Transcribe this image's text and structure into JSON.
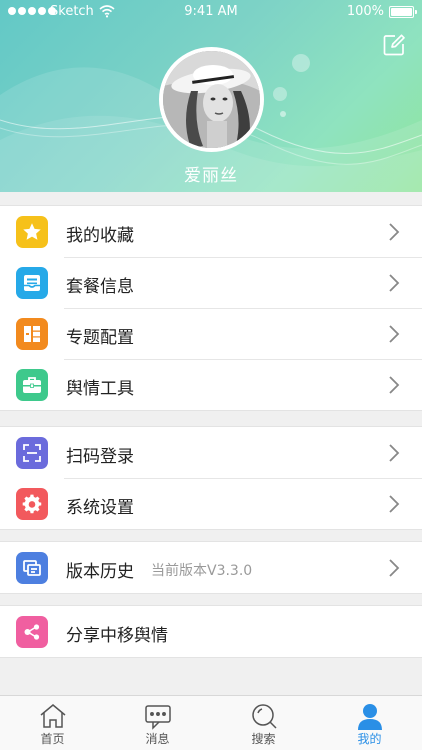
{
  "status_bar": {
    "carrier": "Sketch",
    "time": "9:41 AM",
    "battery": "100%"
  },
  "profile": {
    "name": "爱丽丝"
  },
  "menu": {
    "group1": [
      {
        "label": "我的收藏",
        "icon": "star-icon",
        "color": "#f6c11a"
      },
      {
        "label": "套餐信息",
        "icon": "tray-icon",
        "color": "#26a9e8"
      },
      {
        "label": "专题配置",
        "icon": "grid-icon",
        "color": "#f28a1e"
      },
      {
        "label": "舆情工具",
        "icon": "briefcase-icon",
        "color": "#3ec98c"
      }
    ],
    "group2": [
      {
        "label": "扫码登录",
        "icon": "scan-icon",
        "color": "#6b6bdc"
      },
      {
        "label": "系统设置",
        "icon": "gear-icon",
        "color": "#f2595d"
      }
    ],
    "group3": [
      {
        "label": "版本历史",
        "sub": "当前版本V3.3.0",
        "icon": "version-icon",
        "color": "#4d7fe0"
      }
    ],
    "group4": [
      {
        "label": "分享中移舆情",
        "icon": "share-icon",
        "color": "#f05fa0"
      }
    ]
  },
  "tabbar": [
    {
      "label": "首页",
      "icon": "home-icon"
    },
    {
      "label": "消息",
      "icon": "message-icon"
    },
    {
      "label": "搜索",
      "icon": "search-icon"
    },
    {
      "label": "我的",
      "icon": "person-icon",
      "active": true
    }
  ]
}
